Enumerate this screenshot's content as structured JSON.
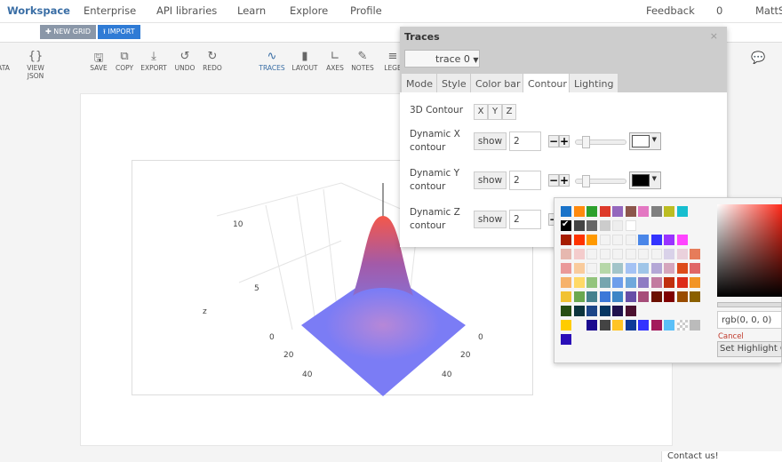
{
  "nav": {
    "items": [
      "Workspace",
      "Enterprise",
      "API libraries",
      "Learn",
      "Explore",
      "Profile"
    ],
    "feedback": "Feedback",
    "count": "0",
    "user": "MattSu"
  },
  "grid": {
    "new_grid": "NEW GRID",
    "import": "IMPORT"
  },
  "toolbar": {
    "data": "ATA",
    "view_json": "VIEW JSON",
    "save": "SAVE",
    "copy": "COPY",
    "export": "EXPORT",
    "undo": "UNDO",
    "redo": "REDO",
    "traces": "TRACES",
    "layout": "LAYOUT",
    "axes": "AXES",
    "notes": "NOTES",
    "legend": "LEGE"
  },
  "plot": {
    "z_label": "z",
    "z_ticks": [
      "10",
      "5",
      "0"
    ],
    "left_ticks": [
      "0",
      "20",
      "40"
    ],
    "right_ticks": [
      "0",
      "20",
      "40"
    ],
    "colors": {
      "low": "#7b7cf5",
      "high": "#f45a4a"
    }
  },
  "panel": {
    "title": "Traces",
    "close": "×",
    "trace_select": "trace 0",
    "tabs": [
      "Mode",
      "Style",
      "Color bar",
      "Contour",
      "Lighting"
    ],
    "active_tab": "Contour",
    "contour3d": {
      "label": "3D Contour",
      "buttons": [
        "X",
        "Y",
        "Z"
      ]
    },
    "rows": [
      {
        "label1": "Dynamic X",
        "label2": "contour",
        "show": "show",
        "value": "2",
        "color": "#ffffff"
      },
      {
        "label1": "Dynamic Y",
        "label2": "contour",
        "show": "show",
        "value": "2",
        "color": "#000000"
      },
      {
        "label1": "Dynamic Z",
        "label2": "contour",
        "show": "show",
        "value": "2",
        "color": "#ffffff"
      }
    ]
  },
  "picker": {
    "palette": [
      [
        "#1a73c9",
        "#ff8a0e",
        "#2ca02c",
        "#dd3a2a",
        "#9467bd",
        "#8c564b",
        "#e377c2",
        "#7f7f7f",
        "#bcbd22",
        "#17becf"
      ],
      [
        "#000000",
        "#444444",
        "#666666",
        "#cccccc",
        "#eeeeee",
        "#ffffff"
      ],
      [
        "#a61c00",
        "#ff3300",
        "#ff9900",
        "#f3f3f3",
        "#f3f3f3",
        "#f3f3f3",
        "#4a86e8",
        "#3333ff",
        "#9933ff",
        "#ff44ff"
      ],
      [
        "#e6b8af",
        "#f4cccc",
        "#f3f3f3",
        "#f3f3f3",
        "#f3f3f3",
        "#f3f3f3",
        "#f3f3f3",
        "#f3f3f3",
        "#d9d2e9",
        "#ead1dc",
        "#e67c5a"
      ],
      [
        "#ea9999",
        "#f9cb9c",
        "#f3f3f3",
        "#b6d7a8",
        "#a2c4c9",
        "#a4c2f4",
        "#9fc5e8",
        "#b4a7d6",
        "#d5a6bd",
        "#dd4b1a",
        "#e06666"
      ],
      [
        "#f6b26b",
        "#ffd966",
        "#93c47d",
        "#76a5af",
        "#6d9eeb",
        "#6fa8dc",
        "#8e7cc3",
        "#c27ba0",
        "#c0300f",
        "#dd2c1a",
        "#f29426"
      ],
      [
        "#f1c232",
        "#6aa84f",
        "#45818e",
        "#3c78d8",
        "#3d85c6",
        "#674ea7",
        "#a64d79",
        "#6b1000",
        "#7f0000",
        "#994c00",
        "#8a6000"
      ],
      [
        "#274e13",
        "#0c343d",
        "#1c4587",
        "#073763",
        "#20124d",
        "#4c1130"
      ],
      [
        "#ffcc00",
        "",
        "#1a0a8f",
        "#444444",
        "#ffc425",
        "#0d3a99",
        "#3333ff",
        "#a3195b",
        "#5bc0f8",
        "transparent",
        "#bbbbbb"
      ],
      [
        "#2a0fb8"
      ]
    ],
    "selected": "#000000",
    "rgb_value": "rgb(0, 0, 0)",
    "cancel": "Cancel",
    "set_highlight": "Set Highlight Color"
  },
  "footer": {
    "contact": "Contact us!"
  }
}
